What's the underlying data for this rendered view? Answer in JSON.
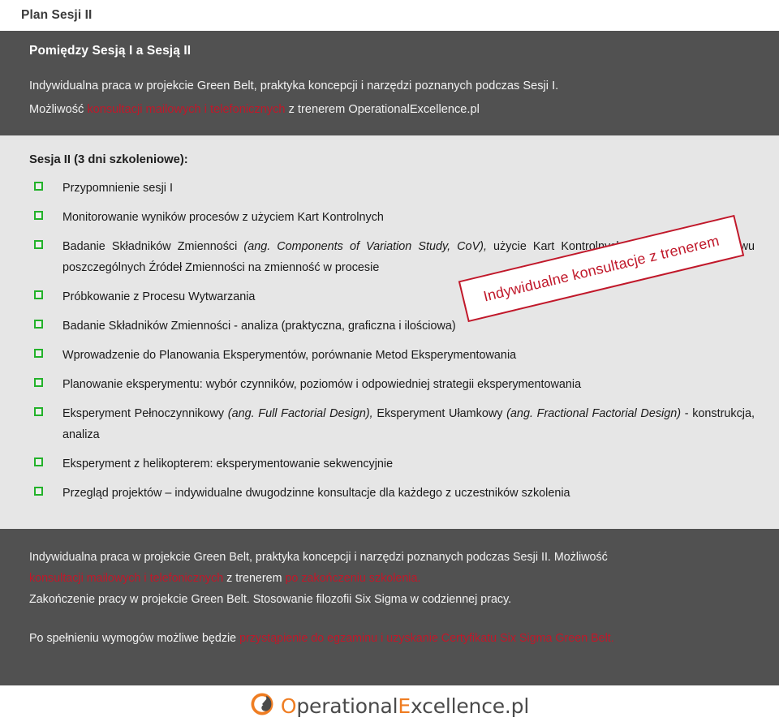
{
  "header": {
    "page_title": "Plan Sesji II"
  },
  "intro": {
    "heading": "Pomiędzy Sesją I a Sesją II",
    "line1": "Indywidualna praca w projekcie Green Belt, praktyka koncepcji i narzędzi poznanych podczas Sesji I.",
    "line2_prefix": "Możliwość ",
    "line2_red": "konsultacji mailowych i telefonicznych",
    "line2_suffix": " z trenerem OperationalExcellence.pl"
  },
  "stamp": {
    "text": "Indywidualne konsultacje z trenerem"
  },
  "main": {
    "section_heading": "Sesja II (3 dni szkoleniowe):",
    "bullets": [
      {
        "parts": [
          {
            "text": "Przypomnienie sesji I",
            "italic": false
          }
        ]
      },
      {
        "parts": [
          {
            "text": "Monitorowanie wyników procesów z użyciem Kart Kontrolnych",
            "italic": false
          }
        ]
      },
      {
        "parts": [
          {
            "text": "Badanie Składników Zmienności ",
            "italic": false
          },
          {
            "text": "(ang. Components of Variation Study, CoV),",
            "italic": true
          },
          {
            "text": " użycie Kart Kontrolnych do szacowania wpływu poszczególnych Źródeł Zmienności na zmienność w procesie",
            "italic": false
          }
        ]
      },
      {
        "parts": [
          {
            "text": "Próbkowanie z Procesu Wytwarzania",
            "italic": false
          }
        ]
      },
      {
        "parts": [
          {
            "text": "Badanie Składników Zmienności  -  analiza (praktyczna, graficzna i ilościowa)",
            "italic": false
          }
        ]
      },
      {
        "parts": [
          {
            "text": "Wprowadzenie do Planowania Eksperymentów, porównanie Metod Eksperymentowania",
            "italic": false
          }
        ]
      },
      {
        "parts": [
          {
            "text": "Planowanie eksperymentu: wybór czynników, poziomów i odpowiedniej strategii eksperymentowania",
            "italic": false
          }
        ]
      },
      {
        "parts": [
          {
            "text": "Eksperyment Pełnoczynnikowy ",
            "italic": false
          },
          {
            "text": "(ang. Full Factorial Design),",
            "italic": true
          },
          {
            "text": " Eksperyment Ułamkowy ",
            "italic": false
          },
          {
            "text": "(ang. Fractional Factorial Design)",
            "italic": true
          },
          {
            "text": "  - konstrukcja, analiza",
            "italic": false
          }
        ]
      },
      {
        "parts": [
          {
            "text": "Eksperyment z helikopterem: eksperymentowanie sekwencyjnie",
            "italic": false
          }
        ]
      },
      {
        "parts": [
          {
            "text": "Przegląd projektów – indywidualne dwugodzinne konsultacje dla każdego z uczestników szkolenia",
            "italic": false
          }
        ]
      }
    ]
  },
  "footer": {
    "line1": "Indywidualna praca w projekcie Green Belt, praktyka koncepcji i narzędzi poznanych podczas Sesji II. Możliwość",
    "line2_red_a": "konsultacji mailowych i telefonicznych",
    "line2_mid": " z trenerem ",
    "line2_red_b": "po zakończeniu szkolenia.",
    "line3": "Zakończenie pracy w projekcie Green Belt.  Stosowanie filozofii Six Sigma w codziennej pracy.",
    "line4_prefix": "Po spełnieniu wymogów możliwe będzie ",
    "line4_red": "przystąpienie do egzaminu i uzyskanie Certyfikatu Six Sigma Green Belt."
  },
  "logo": {
    "text_o": "O",
    "text_mid": "perational",
    "text_e": "E",
    "text_end": "xcellence.pl"
  },
  "colors": {
    "dark_band": "#515151",
    "body_bg": "#e6e6e6",
    "accent_red": "#c0182a",
    "bullet_green": "#23b22a",
    "logo_orange": "#ef7d22"
  }
}
